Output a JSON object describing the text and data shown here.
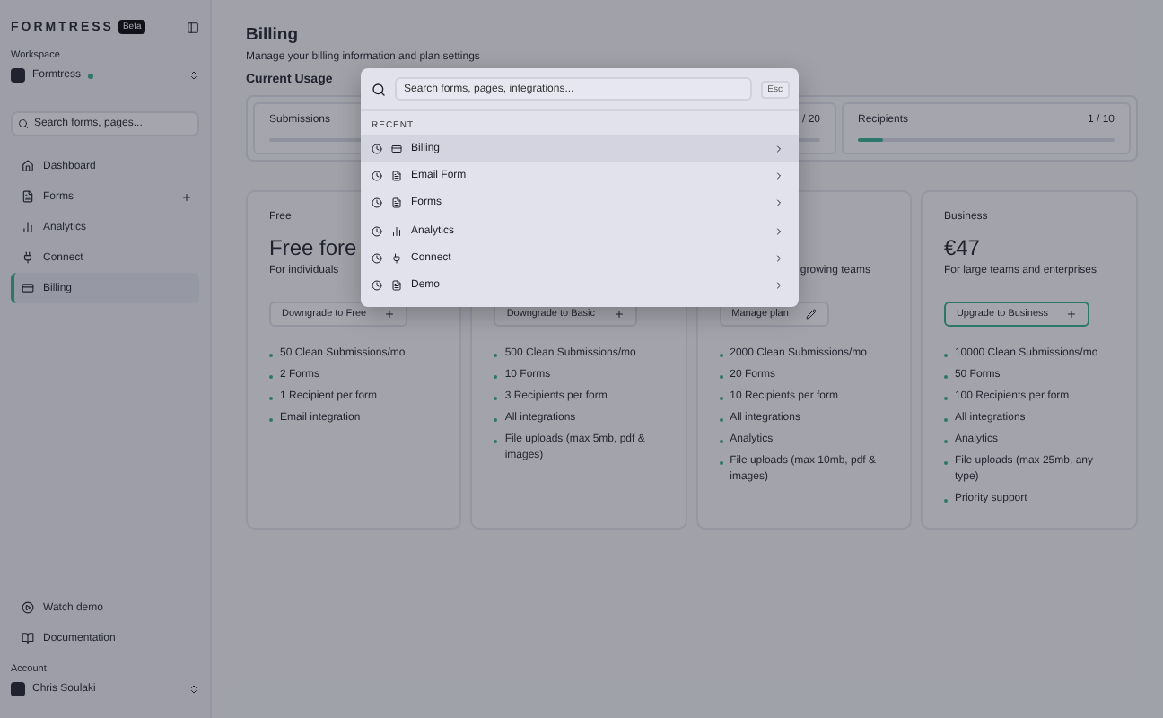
{
  "sidebar": {
    "logo": "FORMTRESS",
    "badge": "Beta",
    "workspace_label": "Workspace",
    "workspace": "Formtress",
    "search": {
      "placeholder": "Search forms, pages..."
    },
    "items": [
      {
        "label": "Dashboard",
        "kind": "home",
        "selected": false
      },
      {
        "label": "Forms",
        "kind": "forms",
        "selected": false
      },
      {
        "label": "Analytics",
        "kind": "analytics",
        "selected": false
      },
      {
        "label": "Connect",
        "kind": "connect",
        "selected": false
      },
      {
        "label": "Billing",
        "kind": "billing",
        "selected": true
      }
    ],
    "links": [
      {
        "label": "Watch demo",
        "kind": "video"
      },
      {
        "label": "Documentation",
        "kind": "book"
      }
    ],
    "account_label": "Account",
    "user": "Chris Soulaki"
  },
  "page": {
    "title": "Billing",
    "subtitle": "Manage your billing information and plan settings",
    "usage_title": "Current Usage",
    "usage": [
      {
        "label": "Submissions"
      },
      {
        "reading": "/ 20"
      },
      {
        "label": "Recipients",
        "reading": "1 / 10",
        "level": 0.1
      }
    ],
    "plans": [
      {
        "name": "Free",
        "price": "Free fore",
        "description": "For individuals",
        "button": "Downgrade to Free",
        "kind": "change",
        "highlighted": false,
        "features": [
          "50 Clean Submissions/mo",
          "2 Forms",
          "1 Recipient per form",
          "Email integration"
        ]
      },
      {
        "button": "Downgrade to Basic",
        "kind": "change",
        "highlighted": false,
        "features": [
          "500 Clean Submissions/mo",
          "10 Forms",
          "3 Recipients per form",
          "All integrations",
          "File uploads (max 5mb, pdf & images)"
        ]
      },
      {
        "description": "growing teams",
        "button": "Manage plan",
        "kind": "manage",
        "highlighted": false,
        "features": [
          "2000 Clean Submissions/mo",
          "20 Forms",
          "10 Recipients per form",
          "All integrations",
          "Analytics",
          "File uploads (max 10mb, pdf & images)"
        ]
      },
      {
        "name": "Business",
        "price": "€47",
        "description": "For large teams and enterprises",
        "button": "Upgrade to Business",
        "kind": "change",
        "highlighted": true,
        "features": [
          "10000 Clean Submissions/mo",
          "50 Forms",
          "100 Recipients per form",
          "All integrations",
          "Analytics",
          "File uploads (max 25mb, any type)",
          "Priority support"
        ]
      }
    ]
  },
  "palette": {
    "search": {
      "placeholder": "Search forms, pages, integrations..."
    },
    "close": "Esc",
    "section": "RECENT",
    "items": [
      {
        "label": "Billing",
        "kind": "billing",
        "selected": true
      },
      {
        "label": "Email Form",
        "kind": "form",
        "selected": false
      },
      {
        "label": "Forms",
        "kind": "form",
        "selected": false
      },
      {
        "label": "Analytics",
        "kind": "analytics",
        "selected": false
      },
      {
        "label": "Connect",
        "kind": "connect",
        "selected": false
      },
      {
        "label": "Demo",
        "kind": "form",
        "selected": false
      }
    ]
  }
}
